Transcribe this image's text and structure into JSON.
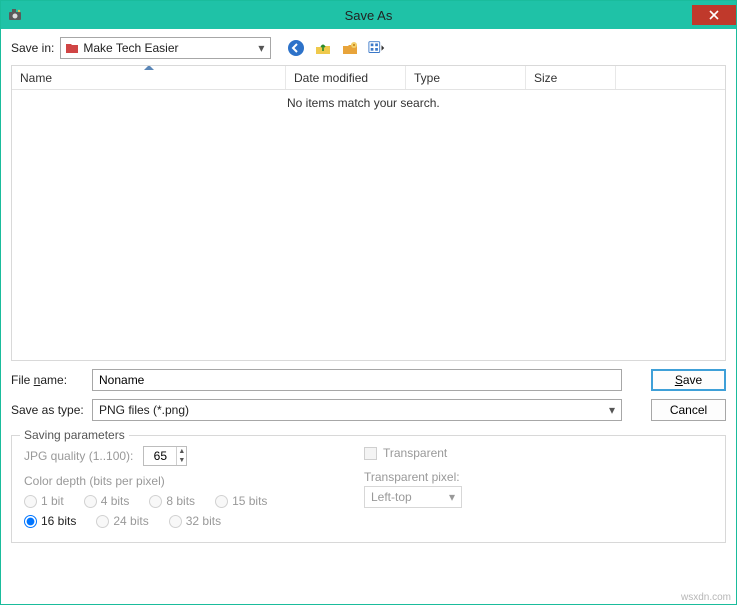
{
  "window": {
    "title": "Save As"
  },
  "toolbar": {
    "save_in_label": "Save in:",
    "folder_name": "Make Tech Easier"
  },
  "columns": {
    "name": "Name",
    "date": "Date modified",
    "type": "Type",
    "size": "Size"
  },
  "list": {
    "empty_message": "No items match your search."
  },
  "form": {
    "filename_label": "File name:",
    "filename_value": "Noname",
    "savetype_label": "Save as type:",
    "savetype_value": "PNG files (*.png)",
    "save_button": "Save",
    "cancel_button": "Cancel"
  },
  "params": {
    "legend": "Saving parameters",
    "jpg_label": "JPG quality (1..100):",
    "jpg_value": "65",
    "colordepth_label": "Color depth (bits per pixel)",
    "bits": {
      "b1": "1 bit",
      "b4": "4 bits",
      "b8": "8 bits",
      "b15": "15 bits",
      "b16": "16 bits",
      "b24": "24 bits",
      "b32": "32 bits"
    },
    "transparent_label": "Transparent",
    "transparent_pixel_label": "Transparent pixel:",
    "transparent_pixel_value": "Left-top"
  },
  "watermark": "wsxdn.com"
}
